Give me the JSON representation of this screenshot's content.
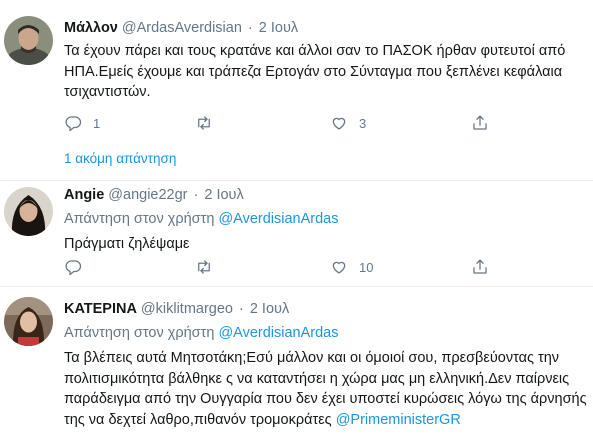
{
  "tweets": [
    {
      "name": "Μάλλον",
      "handle": "@ArdasAverdisian",
      "separator": "·",
      "date": "2 Ιουλ",
      "text": "Τα έχουν πάρει και τους κρατάνε και άλλοι σαν το ΠΑΣΟΚ ήρθαν φυτευτοί από ΗΠΑ.Εμείς έχουμε και τράπεζα Ερτογάν στο Σύνταγμα που ξεπλένει κεφάλαια τσιχαντιστών.",
      "reply_count": "1",
      "retweet_count": "",
      "like_count": "3",
      "more_replies": "1 ακόμη απάντηση"
    },
    {
      "name": "Angie",
      "handle": "@angie22gr",
      "separator": "·",
      "date": "2 Ιουλ",
      "reply_prefix": "Απάντηση στον χρήστη ",
      "reply_to": "@AverdisianArdas",
      "text": "Πράγματι ζηλέψαμε",
      "reply_count": "",
      "retweet_count": "",
      "like_count": "10"
    },
    {
      "name": "ΚΑΤΕΡΙΝΑ",
      "handle": "@kiklitmargeo",
      "separator": "·",
      "date": "2 Ιουλ",
      "reply_prefix": "Απάντηση στον χρήστη ",
      "reply_to": "@AverdisianArdas",
      "text": "Τα βλέπεις αυτά Μητσοτάκη;Εσύ μάλλον και οι όμοιοί σου, πρεσβεύοντας την πολιτισμικότητα βάλθηκε ς να καταντήσει η χώρα μας μη ελληνική.Δεν παίρνεις παράδειγμα από την Ουγγαρία που δεν έχει υποστεί κυρώσεις λόγω της άρνησής της να δεχτεί λαθρο,πιθανόν τρομοκράτες ",
      "text_mention": "@PrimeministerGR"
    }
  ],
  "icons": {
    "reply": "reply-icon",
    "retweet": "retweet-icon",
    "like": "heart-icon",
    "share": "share-icon"
  },
  "colors": {
    "link": "#1b95e0",
    "secondary": "#657786",
    "divider": "#e6ecf0"
  }
}
